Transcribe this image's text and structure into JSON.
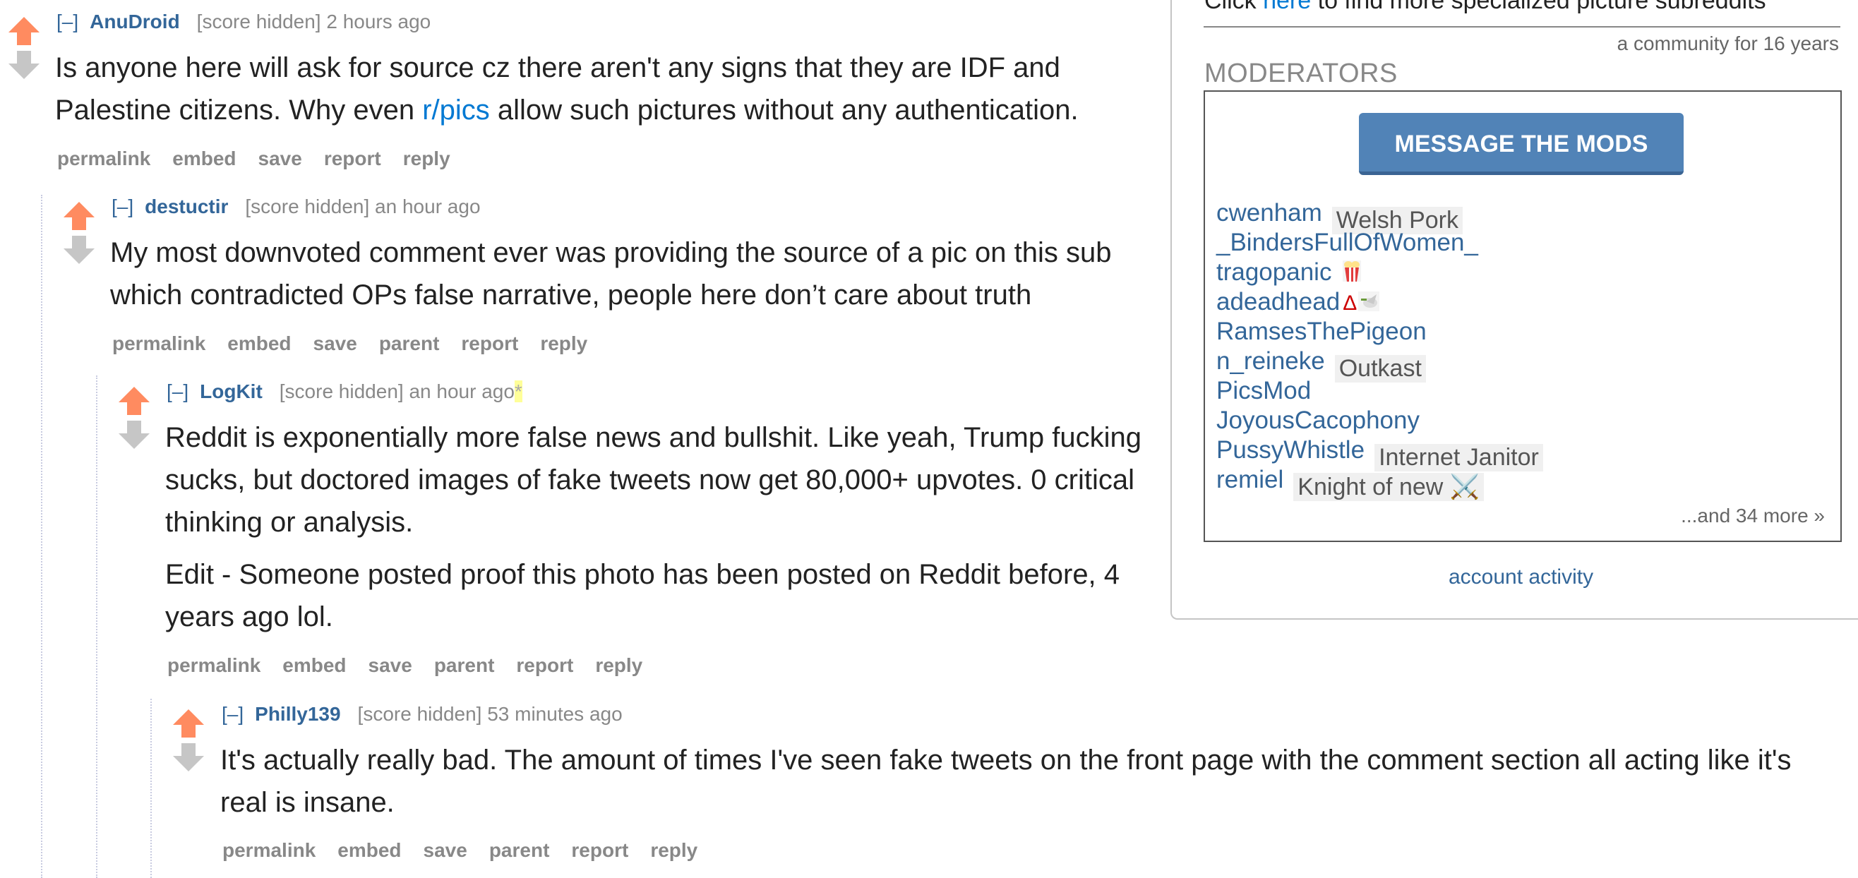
{
  "comments": [
    {
      "expand": "[–]",
      "author": "AnuDroid",
      "meta": "[score hidden] 2 hours ago",
      "body_pre": "Is anyone here will ask for source cz there aren't any signs that they are IDF and Palestine citizens. Why even ",
      "body_link": "r/pics",
      "body_post": " allow such pictures without any authentication.",
      "buttons": [
        "permalink",
        "embed",
        "save",
        "report",
        "reply"
      ]
    },
    {
      "expand": "[–]",
      "author": "destuctir",
      "meta": "[score hidden] an hour ago",
      "body": "My most downvoted comment ever was providing the source of a pic on this sub which contradicted OPs false narrative, people here don’t care about truth",
      "buttons": [
        "permalink",
        "embed",
        "save",
        "parent",
        "report",
        "reply"
      ]
    },
    {
      "expand": "[–]",
      "author": "LogKit",
      "meta": "[score hidden] an hour ago",
      "edited_marker": "*",
      "body_p1": "Reddit is exponentially more false news and bullshit. Like yeah, Trump fucking sucks, but doctored images of fake tweets now get 80,000+ upvotes. 0 critical thinking or analysis.",
      "body_p2": "Edit - Someone posted proof this photo has been posted on Reddit before, 4 years ago lol.",
      "buttons": [
        "permalink",
        "embed",
        "save",
        "parent",
        "report",
        "reply"
      ]
    },
    {
      "expand": "[–]",
      "author": "Philly139",
      "meta": "[score hidden] 53 minutes ago",
      "body": "It's actually really bad. The amount of times I've seen fake tweets on the front page with the comment section all acting like it's real is insane.",
      "buttons": [
        "permalink",
        "embed",
        "save",
        "parent",
        "report",
        "reply"
      ]
    }
  ],
  "sidebar": {
    "top_pre": "Click ",
    "top_link": "here",
    "top_post": " to find more specialized picture subreddits",
    "age": "a community for 16 years",
    "moderators_heading": "MODERATORS",
    "message_button": "MESSAGE THE MODS",
    "mods": [
      {
        "name": "cwenham",
        "flair": "Welsh Pork"
      },
      {
        "name": "_BindersFullOfWomen_",
        "flair": ""
      },
      {
        "name": "tragopanic",
        "flair": ""
      },
      {
        "name": "adeadhead",
        "flair": ""
      },
      {
        "name": "RamsesThePigeon",
        "flair": ""
      },
      {
        "name": "n_reineke",
        "flair": "Outkast"
      },
      {
        "name": "PicsMod",
        "flair": ""
      },
      {
        "name": "JoyousCacophony",
        "flair": ""
      },
      {
        "name": "PussyWhistle",
        "flair": "Internet Janitor"
      },
      {
        "name": "remiel",
        "flair": "Knight of new ⚔️"
      }
    ],
    "more": "...and 34 more »",
    "account_activity": "account activity",
    "delta_glyph": "Δ"
  },
  "colors": {
    "upvote": "#ff8b60",
    "downvote": "#c6c6c6",
    "link": "#0079d3",
    "author": "#336699",
    "button_bg": "#5183b7"
  }
}
